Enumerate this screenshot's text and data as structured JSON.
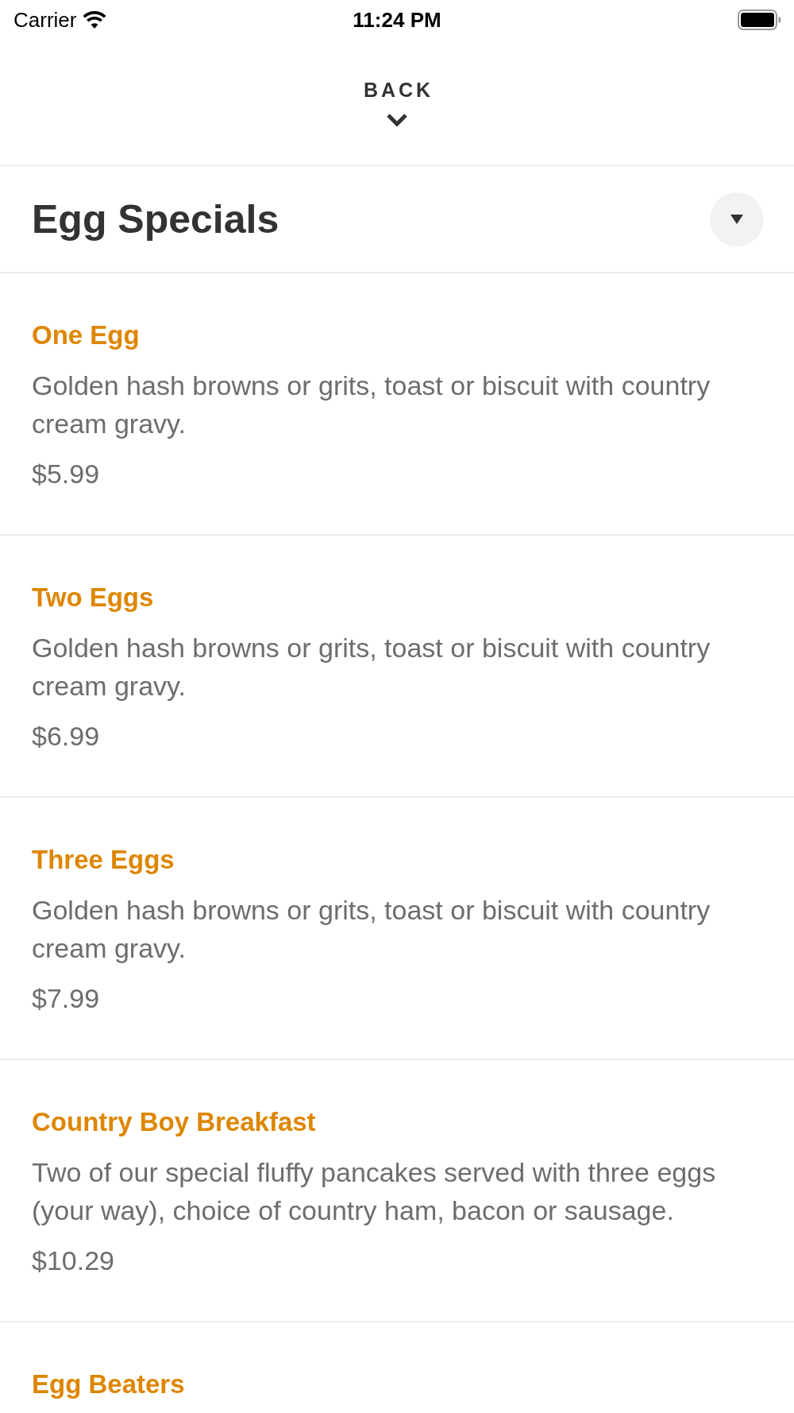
{
  "status_bar": {
    "carrier": "Carrier",
    "time": "11:24 PM"
  },
  "nav": {
    "back_label": "BACK"
  },
  "section": {
    "title": "Egg Specials"
  },
  "items": [
    {
      "name": "One Egg",
      "description": "Golden hash browns or grits, toast or biscuit with country cream gravy.",
      "price": "$5.99"
    },
    {
      "name": "Two Eggs",
      "description": "Golden hash browns or grits, toast or biscuit with country cream gravy.",
      "price": "$6.99"
    },
    {
      "name": "Three Eggs",
      "description": "Golden hash browns or grits, toast or biscuit with country cream gravy.",
      "price": "$7.99"
    },
    {
      "name": "Country Boy Breakfast",
      "description": "Two of our special fluffy pancakes served with three eggs (your way), choice of country ham, bacon or sausage.",
      "price": "$10.29"
    },
    {
      "name": "Egg Beaters"
    }
  ]
}
